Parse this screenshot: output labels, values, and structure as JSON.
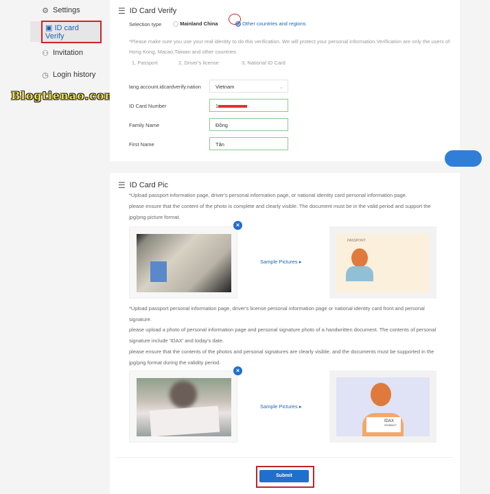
{
  "sidebar": {
    "items": [
      {
        "label": "Settings",
        "icon": "gear-icon"
      },
      {
        "label": "ID card Verify",
        "icon": "id-card-icon",
        "active": true
      },
      {
        "label": "Invitation",
        "icon": "user-icon"
      },
      {
        "label": "Login history",
        "icon": "clock-icon"
      }
    ],
    "watermark": "Blogtienao.com"
  },
  "verify": {
    "title": "ID Card Verify",
    "selection_label": "Selection type",
    "options": [
      "Mainland China",
      "Other countries and regions"
    ],
    "selected": "Other countries and regions",
    "notice1": "*Please make sure you use your real identity to do this verification. We will protect your personal information.Verification are only the users of",
    "notice2": "Hong Kong, Macao,Taiwan and other countries.",
    "docs": [
      "1, Passport",
      "2, Driver's license",
      "3, National ID Card"
    ],
    "nation_label": "lang.account.idcardverify.nation",
    "nation_value": "Vietnam",
    "id_label": "ID Card Number",
    "id_value": "1",
    "family_label": "Family Name",
    "family_value": "Đồng",
    "first_label": "First Name",
    "first_value": "Tân"
  },
  "pic": {
    "title": "ID Card Pic",
    "text1": "*Upload passport information page, driver's personal information page, or national identity card personal information page.",
    "text2": "please ensure that the content of the photo is complete and clearly visible. The document must be in the valid period and support the",
    "text3": "jpg/png picture format.",
    "text4": "*Upload passport personal information page, driver's license personal information page or national identity card front and personal",
    "text5": "signature.",
    "text6": "please upload a photo of personal information page and personal signature photo of a handwritten document. The contents of personal",
    "text7": "signature include 'IDAX' and today's date.",
    "text8": "please ensure that the contents of the photos and personal signatures are clearly visible, and the documents must be supported in the",
    "text9": "jpg/png format during the validity period.",
    "sample_label": "Sample Pictures",
    "passport_label": "PASSPORT",
    "idax_label": "IDAX",
    "idax_date": "20180427",
    "submit": "Submit"
  },
  "colors": {
    "accent": "#1f6fcf",
    "highlight": "#c0212b",
    "input_border": "#8bc78b"
  }
}
